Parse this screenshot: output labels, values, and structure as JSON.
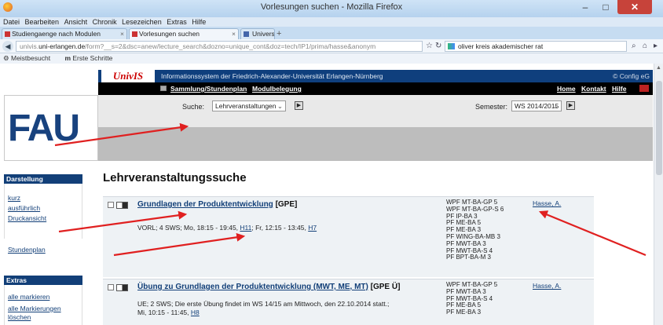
{
  "window": {
    "title": "Vorlesungen suchen - Mozilla Firefox",
    "minimize_label": "–",
    "maximize_label": "□",
    "close_label": "✕"
  },
  "menubar": [
    "Datei",
    "Bearbeiten",
    "Ansicht",
    "Chronik",
    "Lesezeichen",
    "Extras",
    "Hilfe"
  ],
  "tabs": [
    {
      "label": "Studiengaenge nach Modulen",
      "active": false
    },
    {
      "label": "Vorlesungen suchen",
      "active": true
    },
    {
      "label": "Universität Erlangen-Nürnber...",
      "active": false
    }
  ],
  "tab_add": "+",
  "urlbar": {
    "prefix": "univis.",
    "host": "uni-erlangen.de",
    "path": "/form?__s=2&dsc=anew/lecture_search&dozno=unique_cont&doz=tech/IP1/prima/hasse&anonym",
    "search_query": "oliver kreis akademischer rat"
  },
  "bookmarks": {
    "meistbesucht": "Meistbesucht",
    "erste_schritte": "Erste Schritte",
    "im_icon": "m"
  },
  "univis": {
    "logo": "UnivIS",
    "tagline": "Informationssystem der Friedrich-Alexander-Universität Erlangen-Nürnberg",
    "config": "© Config eG",
    "nav": {
      "sammlung": "Sammlung/Stundenplan",
      "modul": "Modulbelegung",
      "home": "Home",
      "kontakt": "Kontakt",
      "hilfe": "Hilfe"
    },
    "fau_logo": "FAU",
    "search": {
      "label": "Suche:",
      "selected": "Lehrveranstaltungen",
      "semester_label": "Semester:",
      "semester_selected": "WS 2014/2015"
    }
  },
  "sidebar": {
    "darstellung_title": "Darstellung",
    "darstellung_links": [
      "kurz",
      "ausführlich",
      "Druckansicht"
    ],
    "stundenplan": "Stundenplan",
    "extras_title": "Extras",
    "extras_links": [
      "alle markieren",
      "alle Markierungen",
      "löschen"
    ]
  },
  "main": {
    "title": "Lehrveranstaltungssuche",
    "courses": [
      {
        "title": "Grundlagen der Produktentwicklung",
        "abbr": "[GPE]",
        "details_prefix": "VORL; 4 SWS; Mo, 18:15 - 19:45,",
        "room1": "H11",
        "details_mid": "; Fr, 12:15 - 13:45,",
        "room2": "H7",
        "modules": [
          "WPF MT-BA-GP 5",
          "WPF MT-BA-GP-S 6",
          "PF IP-BA 3",
          "PF ME-BA 5",
          "PF ME-BA 3",
          "PF WING-BA-MB 3",
          "PF MWT-BA 3",
          "PF MWT-BA-S 4",
          "PF BPT-BA-M 3"
        ],
        "lecturer": "Hasse, A."
      },
      {
        "title": "Übung zu Grundlagen der Produktentwicklung (MWT, ME, MT)",
        "abbr": "[GPE Ü]",
        "details_prefix": "UE; 2 SWS; Die erste Übung findet im WS 14/15 am Mittwoch, den 22.10.2014 statt.; Mi, 10:15 - 11:45,",
        "room1": "H8",
        "modules": [
          "WPF MT-BA-GP 5",
          "PF MWT-BA 3",
          "PF MWT-BA-S 4",
          "PF ME-BA 5",
          "PF ME-BA 3"
        ],
        "lecturer": "Hasse, A."
      }
    ]
  },
  "colors": {
    "univis_blue": "#0f3f7d",
    "link_blue": "#123f78",
    "annotation_red": "#e02020",
    "close_red": "#c7433a"
  }
}
